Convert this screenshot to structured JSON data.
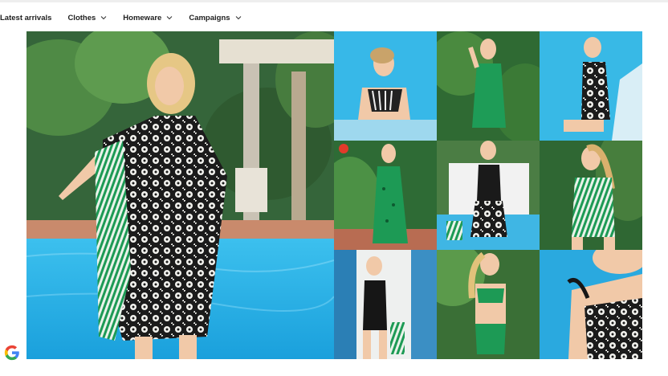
{
  "nav": {
    "items": [
      {
        "label": "Latest arrivals",
        "has_dropdown": false
      },
      {
        "label": "Clothes",
        "has_dropdown": true
      },
      {
        "label": "Homeware",
        "has_dropdown": true
      },
      {
        "label": "Campaigns",
        "has_dropdown": true
      }
    ]
  },
  "icons": {
    "dropdown": "chevron-down-icon",
    "badge": "google-icon"
  },
  "colors": {
    "text": "#1e1e1e",
    "pool": "#2fb4e6",
    "foliage": "#2f6b3a",
    "print_green": "#1d9a55"
  }
}
